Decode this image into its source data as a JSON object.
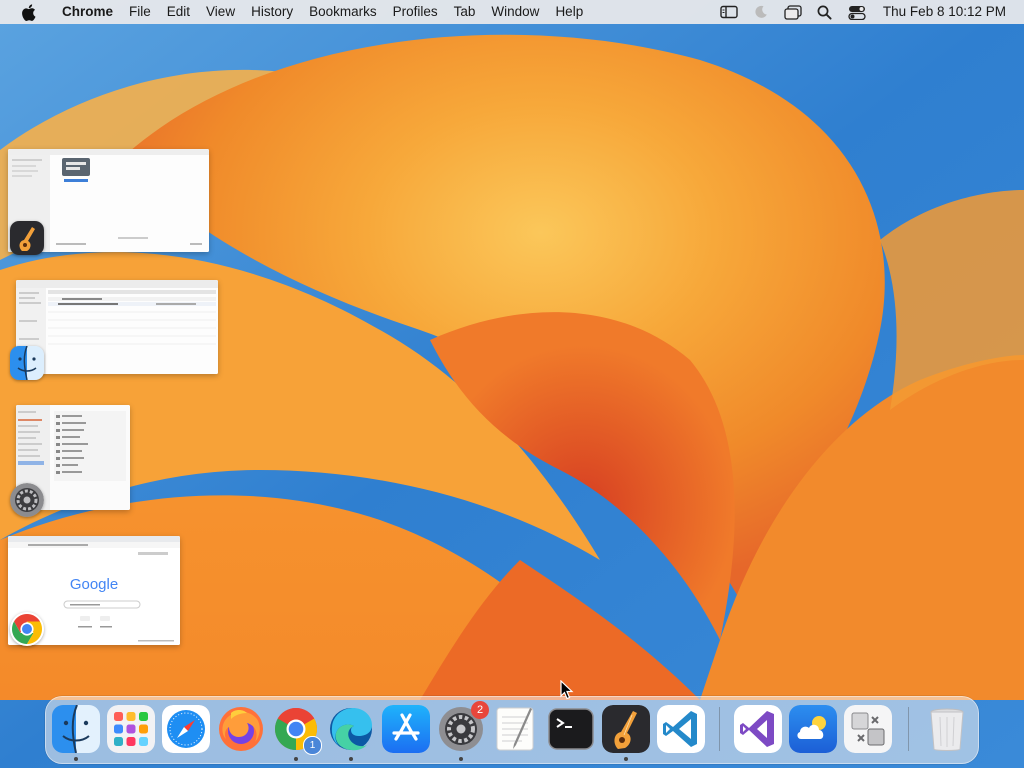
{
  "menubar": {
    "app_name": "Chrome",
    "items": [
      "File",
      "Edit",
      "View",
      "History",
      "Bookmarks",
      "Profiles",
      "Tab",
      "Window",
      "Help"
    ],
    "status_icons": [
      "sidebar-icon",
      "moon-icon",
      "window-stack-icon",
      "search-icon",
      "control-center-icon"
    ],
    "clock": "Thu Feb 8  10:12 PM"
  },
  "stage_windows": [
    {
      "app": "GarageBand",
      "icon": "garageband-icon"
    },
    {
      "app": "Finder",
      "icon": "finder-icon"
    },
    {
      "app": "System Settings",
      "icon": "system-settings-icon"
    },
    {
      "app": "Chrome",
      "icon": "chrome-icon",
      "page_logo": "Google"
    }
  ],
  "dock": {
    "items": [
      {
        "app": "Finder",
        "icon": "finder-icon",
        "running": true
      },
      {
        "app": "Launchpad",
        "icon": "launchpad-icon",
        "running": false
      },
      {
        "app": "Safari",
        "icon": "safari-icon",
        "running": false
      },
      {
        "app": "Firefox",
        "icon": "firefox-icon",
        "running": false
      },
      {
        "app": "Chrome",
        "icon": "chrome-icon",
        "running": true,
        "sub_badge": "1"
      },
      {
        "app": "Edge",
        "icon": "edge-icon",
        "running": true
      },
      {
        "app": "App Store",
        "icon": "app-store-icon",
        "running": false
      },
      {
        "app": "System Settings",
        "icon": "system-settings-icon",
        "running": true,
        "badge": "2"
      },
      {
        "app": "TextEdit",
        "icon": "textedit-icon",
        "running": false
      },
      {
        "app": "Terminal",
        "icon": "terminal-icon",
        "running": false
      },
      {
        "app": "GarageBand",
        "icon": "garageband-icon",
        "running": true
      },
      {
        "app": "VS Code",
        "icon": "vscode-icon",
        "running": false
      },
      {
        "app": "Visual Studio",
        "icon": "visual-studio-icon",
        "running": false
      },
      {
        "app": "Weather",
        "icon": "weather-icon",
        "running": false
      },
      {
        "app": "Migration Assistant",
        "icon": "migration-icon",
        "running": false
      },
      {
        "app": "Trash",
        "icon": "trash-icon",
        "running": false
      }
    ]
  },
  "colors": {
    "accent_orange": "#f5a22a",
    "sky_blue": "#2f7fd0",
    "badge_red": "#e8463c"
  }
}
